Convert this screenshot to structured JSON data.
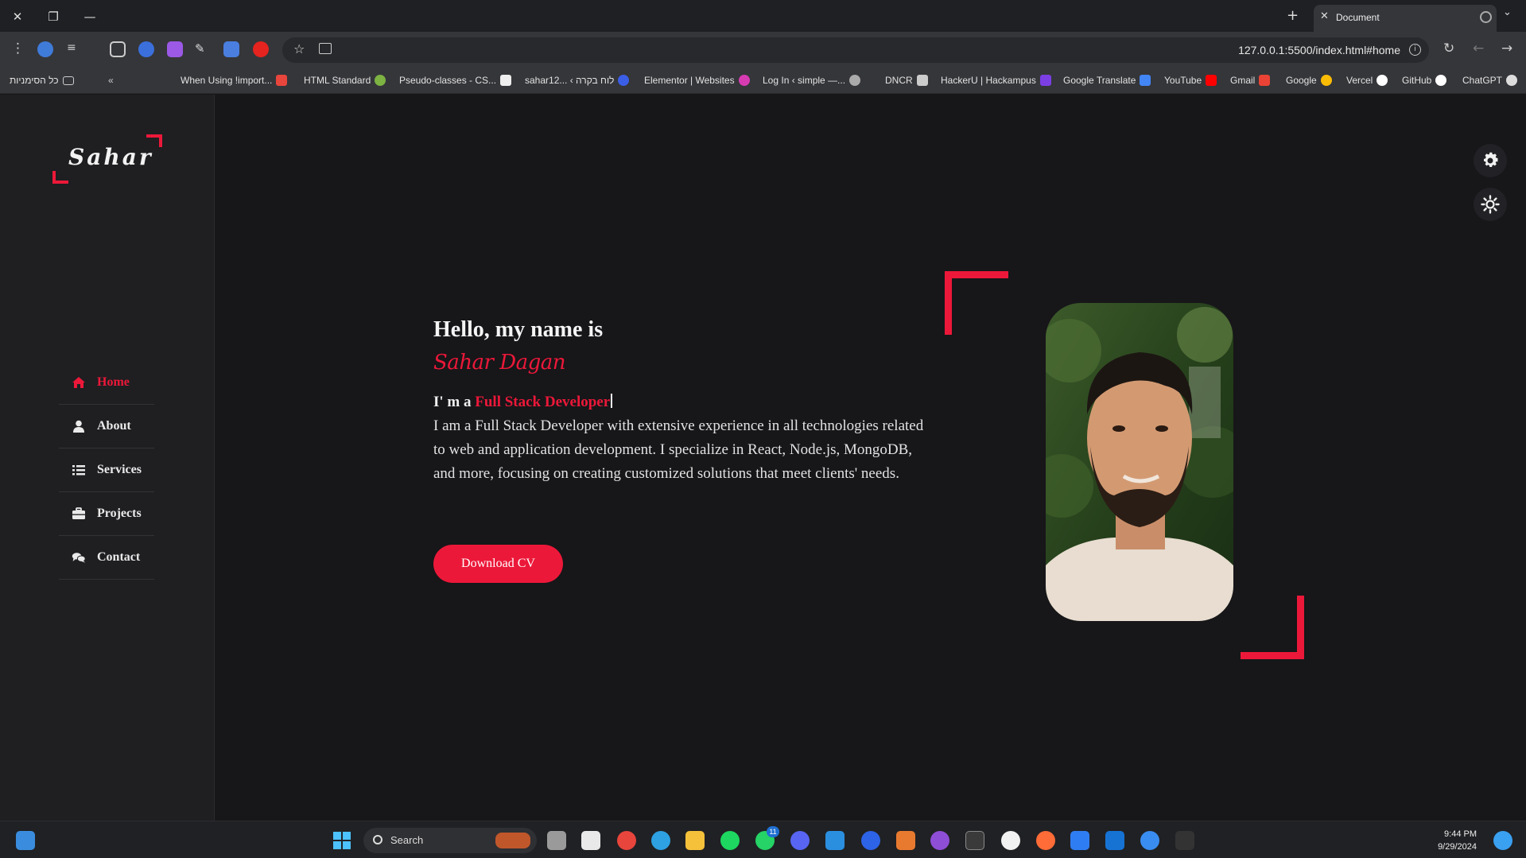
{
  "browser": {
    "tab_title": "Document",
    "url": "127.0.0.1:5500/index.html#home",
    "bookmarks_folder": "כל הסימניות",
    "bookmarks": [
      {
        "label": "When Using !import...",
        "color": "#e8453c"
      },
      {
        "label": "HTML Standard",
        "color": "#7cb342"
      },
      {
        "label": "Pseudo-classes - CS...",
        "color": "#eeeeee"
      },
      {
        "label": "sahar12... ‹ לוח בקרה",
        "color": "#3b5ee6"
      },
      {
        "label": "Elementor | Websites",
        "color": "#d63bb2"
      },
      {
        "label": "Log In ‹ simple —...",
        "color": "#aaaaaa"
      },
      {
        "label": "DNCR",
        "color": "#cccccc"
      },
      {
        "label": "HackerU | Hackampus",
        "color": "#7b3fe4"
      },
      {
        "label": "Google Translate",
        "color": "#4285f4"
      },
      {
        "label": "YouTube",
        "color": "#ff0000"
      },
      {
        "label": "Gmail",
        "color": "#ea4335"
      },
      {
        "label": "Google",
        "color": "#fbbc05"
      },
      {
        "label": "Vercel",
        "color": "#ffffff"
      },
      {
        "label": "GitHub",
        "color": "#ffffff"
      },
      {
        "label": "ChatGPT",
        "color": "#dddddd"
      }
    ]
  },
  "site": {
    "logo": "Sahar",
    "nav": [
      {
        "label": "Home",
        "icon": "home-icon",
        "active": true
      },
      {
        "label": "About",
        "icon": "user-icon",
        "active": false
      },
      {
        "label": "Services",
        "icon": "list-icon",
        "active": false
      },
      {
        "label": "Projects",
        "icon": "briefcase-icon",
        "active": false
      },
      {
        "label": "Contact",
        "icon": "comments-icon",
        "active": false
      }
    ],
    "hero": {
      "greeting": "Hello, my name is",
      "name": "Sahar Dagan",
      "role_prefix": "I' m a",
      "role_typed": "Full Stack Developer",
      "description": "I am a Full Stack Developer with extensive experience in all technologies related to web and application development. I specialize in React, Node.js, MongoDB, and more, focusing on creating customized solutions that meet clients' needs.",
      "cta": "Download CV"
    },
    "accent_color": "#ec1839",
    "background_color": "#171619"
  },
  "taskbar": {
    "search_placeholder": "Search",
    "time": "9:44 PM",
    "date": "9/29/2024",
    "whatsapp_badge": "11"
  }
}
